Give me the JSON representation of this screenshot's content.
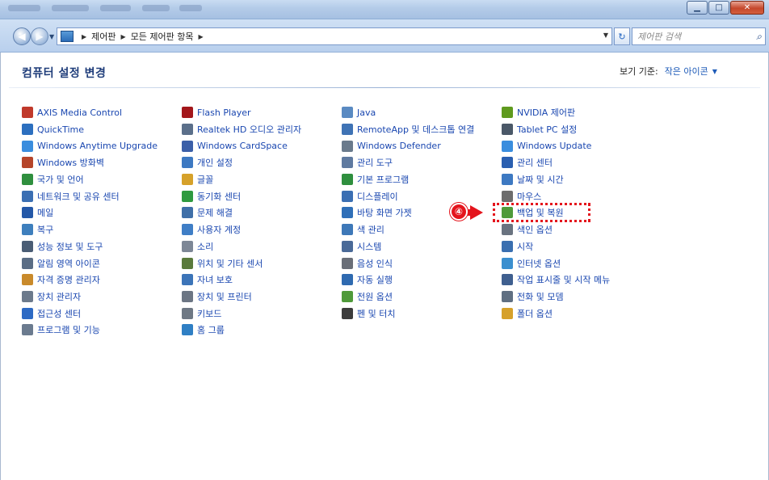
{
  "address_bar": {
    "crumbs": [
      "제어판",
      "모든 제어판 항목"
    ],
    "search_placeholder": "제어판 검색"
  },
  "header": {
    "title": "컴퓨터 설정 변경",
    "view_by_label": "보기 기준:",
    "view_by_value": "작은 아이콘"
  },
  "annotation": {
    "step": "④"
  },
  "columns": [
    [
      {
        "label": "AXIS Media Control",
        "icon": "axis-icon",
        "color": "#c0392b"
      },
      {
        "label": "QuickTime",
        "icon": "quicktime-icon",
        "color": "#2c6fbf"
      },
      {
        "label": "Windows Anytime Upgrade",
        "icon": "windows-flag-icon",
        "color": "#3a8dde"
      },
      {
        "label": "Windows 방화벽",
        "icon": "firewall-icon",
        "color": "#b5452a"
      },
      {
        "label": "국가 및 언어",
        "icon": "globe-icon",
        "color": "#2f8f3e"
      },
      {
        "label": "네트워크 및 공유 센터",
        "icon": "network-icon",
        "color": "#3b6fb3"
      },
      {
        "label": "메일",
        "icon": "mail-icon",
        "color": "#2458a8"
      },
      {
        "label": "복구",
        "icon": "recovery-icon",
        "color": "#3e7fbd"
      },
      {
        "label": "성능 정보 및 도구",
        "icon": "performance-icon",
        "color": "#4a5d75"
      },
      {
        "label": "알림 영역 아이콘",
        "icon": "notification-icon",
        "color": "#5a6d85"
      },
      {
        "label": "자격 증명 관리자",
        "icon": "credential-icon",
        "color": "#c98a2b"
      },
      {
        "label": "장치 관리자",
        "icon": "device-manager-icon",
        "color": "#6c7a8c"
      },
      {
        "label": "접근성 센터",
        "icon": "accessibility-icon",
        "color": "#2d6ac4"
      },
      {
        "label": "프로그램 및 기능",
        "icon": "programs-icon",
        "color": "#6b7b8f"
      }
    ],
    [
      {
        "label": "Flash Player",
        "icon": "flash-icon",
        "color": "#a3171b"
      },
      {
        "label": "Realtek HD 오디오 관리자",
        "icon": "realtek-icon",
        "color": "#5b6f8a"
      },
      {
        "label": "Windows CardSpace",
        "icon": "cardspace-icon",
        "color": "#3b5fa8"
      },
      {
        "label": "개인 설정",
        "icon": "personalization-icon",
        "color": "#3d79c2"
      },
      {
        "label": "글꼴",
        "icon": "fonts-icon",
        "color": "#d6a12a"
      },
      {
        "label": "동기화 센터",
        "icon": "sync-icon",
        "color": "#2f9a3f"
      },
      {
        "label": "문제 해결",
        "icon": "troubleshoot-icon",
        "color": "#3f6fa8"
      },
      {
        "label": "사용자 계정",
        "icon": "user-accounts-icon",
        "color": "#3f7ec6"
      },
      {
        "label": "소리",
        "icon": "sound-icon",
        "color": "#7d8796"
      },
      {
        "label": "위치 및 기타 센서",
        "icon": "sensor-icon",
        "color": "#5a7a3c"
      },
      {
        "label": "자녀 보호",
        "icon": "parental-icon",
        "color": "#3c74b8"
      },
      {
        "label": "장치 및 프린터",
        "icon": "printer-icon",
        "color": "#6c7684"
      },
      {
        "label": "키보드",
        "icon": "keyboard-icon",
        "color": "#6e7884"
      },
      {
        "label": "홈 그룹",
        "icon": "homegroup-icon",
        "color": "#2f7fc4"
      }
    ],
    [
      {
        "label": "Java",
        "icon": "java-icon",
        "color": "#5a8ac2"
      },
      {
        "label": "RemoteApp 및 데스크톱 연결",
        "icon": "remoteapp-icon",
        "color": "#3f73b5"
      },
      {
        "label": "Windows Defender",
        "icon": "defender-icon",
        "color": "#6a7a8c"
      },
      {
        "label": "관리 도구",
        "icon": "admin-tools-icon",
        "color": "#5f7aa0"
      },
      {
        "label": "기본 프로그램",
        "icon": "default-programs-icon",
        "color": "#2f8f3e"
      },
      {
        "label": "디스플레이",
        "icon": "display-icon",
        "color": "#3b6fb3"
      },
      {
        "label": "바탕 화면 가젯",
        "icon": "gadgets-icon",
        "color": "#2f6fb8"
      },
      {
        "label": "색 관리",
        "icon": "color-management-icon",
        "color": "#3e78b8"
      },
      {
        "label": "시스템",
        "icon": "system-icon",
        "color": "#4a6a98"
      },
      {
        "label": "음성 인식",
        "icon": "speech-icon",
        "color": "#6a6f78"
      },
      {
        "label": "자동 실행",
        "icon": "autoplay-icon",
        "color": "#2f6ab0"
      },
      {
        "label": "전원 옵션",
        "icon": "power-icon",
        "color": "#4f9a3a"
      },
      {
        "label": "펜 및 터치",
        "icon": "pen-icon",
        "color": "#3c3c3c"
      }
    ],
    [
      {
        "label": "NVIDIA 제어판",
        "icon": "nvidia-icon",
        "color": "#5f9a1e"
      },
      {
        "label": "Tablet PC 설정",
        "icon": "tablet-icon",
        "color": "#4a5868"
      },
      {
        "label": "Windows Update",
        "icon": "windows-update-icon",
        "color": "#3a8dde"
      },
      {
        "label": "관리 센터",
        "icon": "action-center-icon",
        "color": "#2a5fb0"
      },
      {
        "label": "날짜 및 시간",
        "icon": "clock-icon",
        "color": "#3d79c2"
      },
      {
        "label": "마우스",
        "icon": "mouse-icon",
        "color": "#6d6d6d"
      },
      {
        "label": "백업 및 복원",
        "icon": "backup-icon",
        "color": "#4f9a3a"
      },
      {
        "label": "색인 옵션",
        "icon": "indexing-icon",
        "color": "#6a7380"
      },
      {
        "label": "시작",
        "icon": "getting-started-icon",
        "color": "#3a6fb0"
      },
      {
        "label": "인터넷 옵션",
        "icon": "internet-options-icon",
        "color": "#3b8fcf"
      },
      {
        "label": "작업 표시줄 및 시작 메뉴",
        "icon": "taskbar-icon",
        "color": "#3f5f8f"
      },
      {
        "label": "전화 및 모뎀",
        "icon": "phone-modem-icon",
        "color": "#5f6f82"
      },
      {
        "label": "폴더 옵션",
        "icon": "folder-options-icon",
        "color": "#d6a12a"
      }
    ]
  ]
}
